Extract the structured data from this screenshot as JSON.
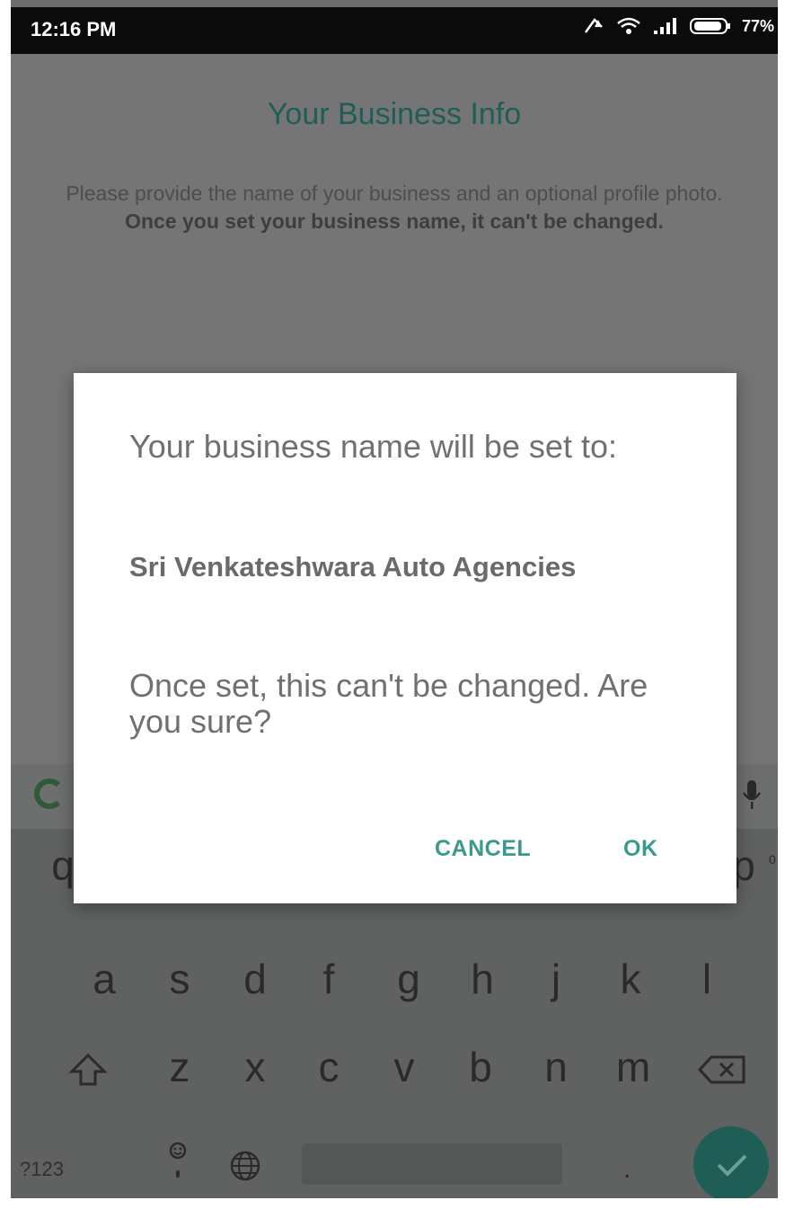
{
  "status_bar": {
    "time": "12:16 PM",
    "battery": "77%"
  },
  "screen": {
    "title": "Your Business Info",
    "description_prefix": "Please provide the name of your business and an optional profile photo.",
    "description_bold": "Once you set your business name, it can't be changed."
  },
  "dialog": {
    "message": "Your business name will be set to:",
    "business_name": "Sri Venkateshwara Auto Agencies",
    "confirm": "Once set, this can't be changed. Are you sure?",
    "cancel_label": "CANCEL",
    "ok_label": "OK"
  },
  "keyboard": {
    "row1_visible": [
      "q",
      "p"
    ],
    "row1_hint": "0",
    "row2": [
      "a",
      "s",
      "d",
      "f",
      "g",
      "h",
      "j",
      "k",
      "l"
    ],
    "row3": [
      "z",
      "x",
      "c",
      "v",
      "b",
      "n",
      "m"
    ],
    "symbols_label": "?123",
    "period": ".",
    "icons": [
      "google-icon",
      "mic-icon",
      "shift-icon",
      "backspace-icon",
      "emoji-icon",
      "globe-icon",
      "check-icon"
    ]
  },
  "colors": {
    "accent": "#3b9a8d",
    "title_teal": "#1f5e57",
    "scrim": "#757575"
  }
}
